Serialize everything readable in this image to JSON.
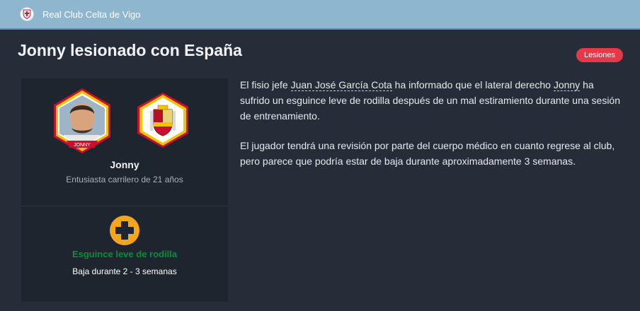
{
  "header": {
    "club_name": "Real Club Celta de Vigo",
    "crest_icon": "club-crest-icon",
    "bar_color": "#8fb6cf"
  },
  "news": {
    "title": "Jonny lesionado con España",
    "tag": "Lesiones",
    "tag_color": "#e5394a"
  },
  "player": {
    "name": "Jonny",
    "badge_label": "JONNY",
    "description": "Entusiasta carrilero de 21 años",
    "nation_icon": "spain-crest-icon"
  },
  "injury": {
    "icon": "injury-plus-icon",
    "name": "Esguince leve de rodilla",
    "duration": "Baja durante 2 - 3 semanas",
    "name_color": "#0f8a3c",
    "icon_color": "#f5a61b"
  },
  "article": {
    "p1_a": "El fisio jefe ",
    "physio_link": "Juan José García Cota",
    "p1_b": " ha informado que el lateral derecho ",
    "player_link": "Jonny",
    "p1_c": " ha sufrido un esguince leve de rodilla después de un mal estiramiento durante una sesión de entrenamiento.",
    "p2": "El jugador tendrá una revisión por parte del cuerpo médico en cuanto regrese al club, pero parece que podría estar de baja durante aproximadamente 3 semanas."
  }
}
